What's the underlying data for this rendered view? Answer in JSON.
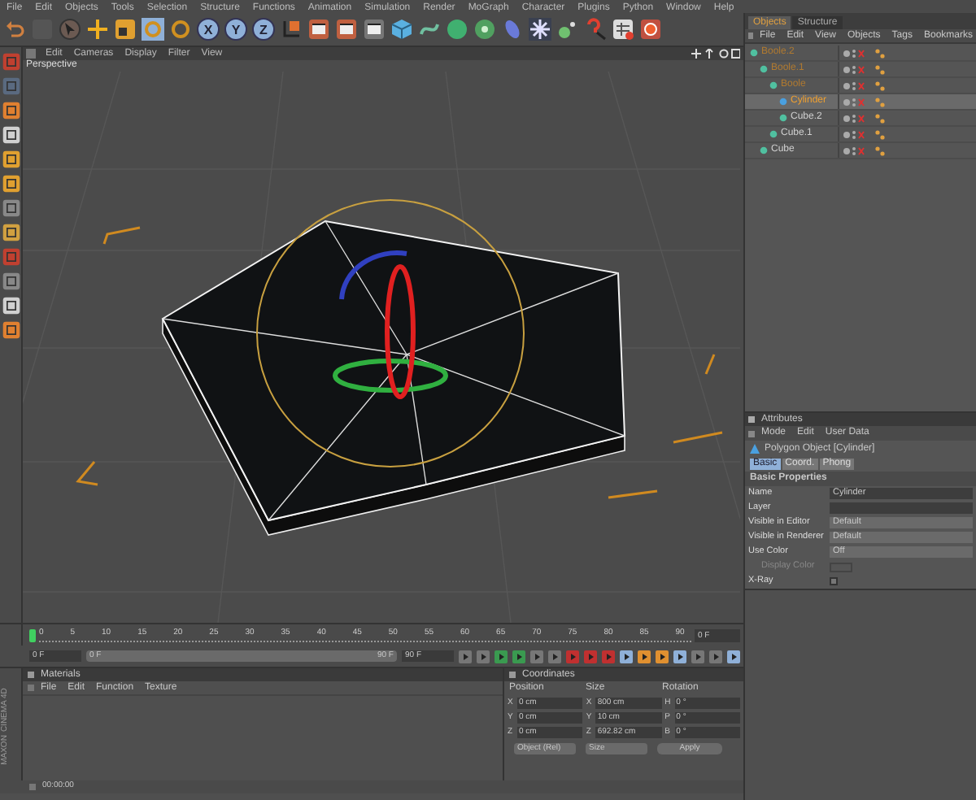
{
  "menu_bar": [
    "File",
    "Edit",
    "Objects",
    "Tools",
    "Selection",
    "Structure",
    "Functions",
    "Animation",
    "Simulation",
    "Render",
    "MoGraph",
    "Character",
    "Plugins",
    "Python",
    "Window",
    "Help"
  ],
  "axis_toggles": [
    {
      "label": "X",
      "selected": true
    },
    {
      "label": "Y",
      "selected": true
    },
    {
      "label": "Z",
      "selected": true
    }
  ],
  "viewport": {
    "menu": [
      "Edit",
      "Cameras",
      "Display",
      "Filter",
      "View"
    ],
    "title": "Perspective"
  },
  "object_manager": {
    "tabs": [
      {
        "label": "Objects",
        "selected": true
      },
      {
        "label": "Structure",
        "selected": false
      }
    ],
    "menu": [
      "File",
      "Edit",
      "View",
      "Objects",
      "Tags",
      "Bookmarks"
    ],
    "tree": [
      {
        "name": "Boole.2",
        "selected": false,
        "highlighted": true,
        "children": [
          {
            "name": "Boole.1",
            "selected": false,
            "highlighted": true,
            "children": [
              {
                "name": "Boole",
                "selected": false,
                "highlighted": true,
                "children": [
                  {
                    "name": "Cylinder",
                    "selected": true,
                    "highlighted": false
                  },
                  {
                    "name": "Cube.2",
                    "selected": false,
                    "highlighted": false
                  }
                ]
              },
              {
                "name": "Cube.1",
                "selected": false,
                "highlighted": false
              }
            ]
          },
          {
            "name": "Cube",
            "selected": false,
            "highlighted": false
          }
        ]
      }
    ]
  },
  "attributes": {
    "title": "Attributes",
    "menu": [
      "Mode",
      "Edit",
      "User Data"
    ],
    "object_title": "Polygon Object [Cylinder]",
    "tabs": [
      {
        "label": "Basic",
        "selected": true
      },
      {
        "label": "Coord.",
        "selected": false
      },
      {
        "label": "Phong",
        "selected": false
      }
    ],
    "section": "Basic Properties",
    "fields": [
      {
        "label": "Name",
        "kind": "text",
        "value": "Cylinder",
        "disabled": false
      },
      {
        "label": "Layer",
        "kind": "text",
        "disabled": false
      },
      {
        "label": "Visible in Editor",
        "kind": "dropdown",
        "value": "Default",
        "disabled": false
      },
      {
        "label": "Visible in Renderer",
        "kind": "dropdown",
        "value": "Default",
        "disabled": false
      },
      {
        "label": "Use Color",
        "kind": "dropdown",
        "value": "Off",
        "disabled": false
      },
      {
        "label": "Display Color",
        "kind": "color",
        "disabled": true
      },
      {
        "label": "X-Ray",
        "kind": "checkbox",
        "checked": false,
        "disabled": false
      }
    ]
  },
  "timeline": {
    "ticks": [
      "0",
      "5",
      "10",
      "15",
      "20",
      "25",
      "30",
      "35",
      "40",
      "45",
      "50",
      "55",
      "60",
      "65",
      "70",
      "75",
      "80",
      "85",
      "90"
    ],
    "current": "0 F"
  },
  "transport": {
    "start": "0 F",
    "range_start": "0 F",
    "range_end": "90 F",
    "level": 1,
    "end": "90 F"
  },
  "materials": {
    "title": "Materials",
    "menu": [
      "File",
      "Edit",
      "Function",
      "Texture"
    ]
  },
  "coordinates": {
    "title": "Coordinates",
    "headers": [
      "Position",
      "Size",
      "Rotation"
    ],
    "rows": [
      {
        "pos_axis": "X",
        "pos": "0 cm",
        "size_axis": "X",
        "size": "800 cm",
        "rot_axis": "H",
        "rot": "0 °"
      },
      {
        "pos_axis": "Y",
        "pos": "0 cm",
        "size_axis": "Y",
        "size": "10 cm",
        "rot_axis": "P",
        "rot": "0 °"
      },
      {
        "pos_axis": "Z",
        "pos": "0 cm",
        "size_axis": "Z",
        "size": "692.82 cm",
        "rot_axis": "B",
        "rot": "0 °"
      }
    ],
    "mode": "Object (Rel)",
    "size_mode": "Size",
    "apply": "Apply"
  },
  "status": "00:00:00",
  "brand": [
    "MAXON",
    "CINEMA 4D"
  ]
}
